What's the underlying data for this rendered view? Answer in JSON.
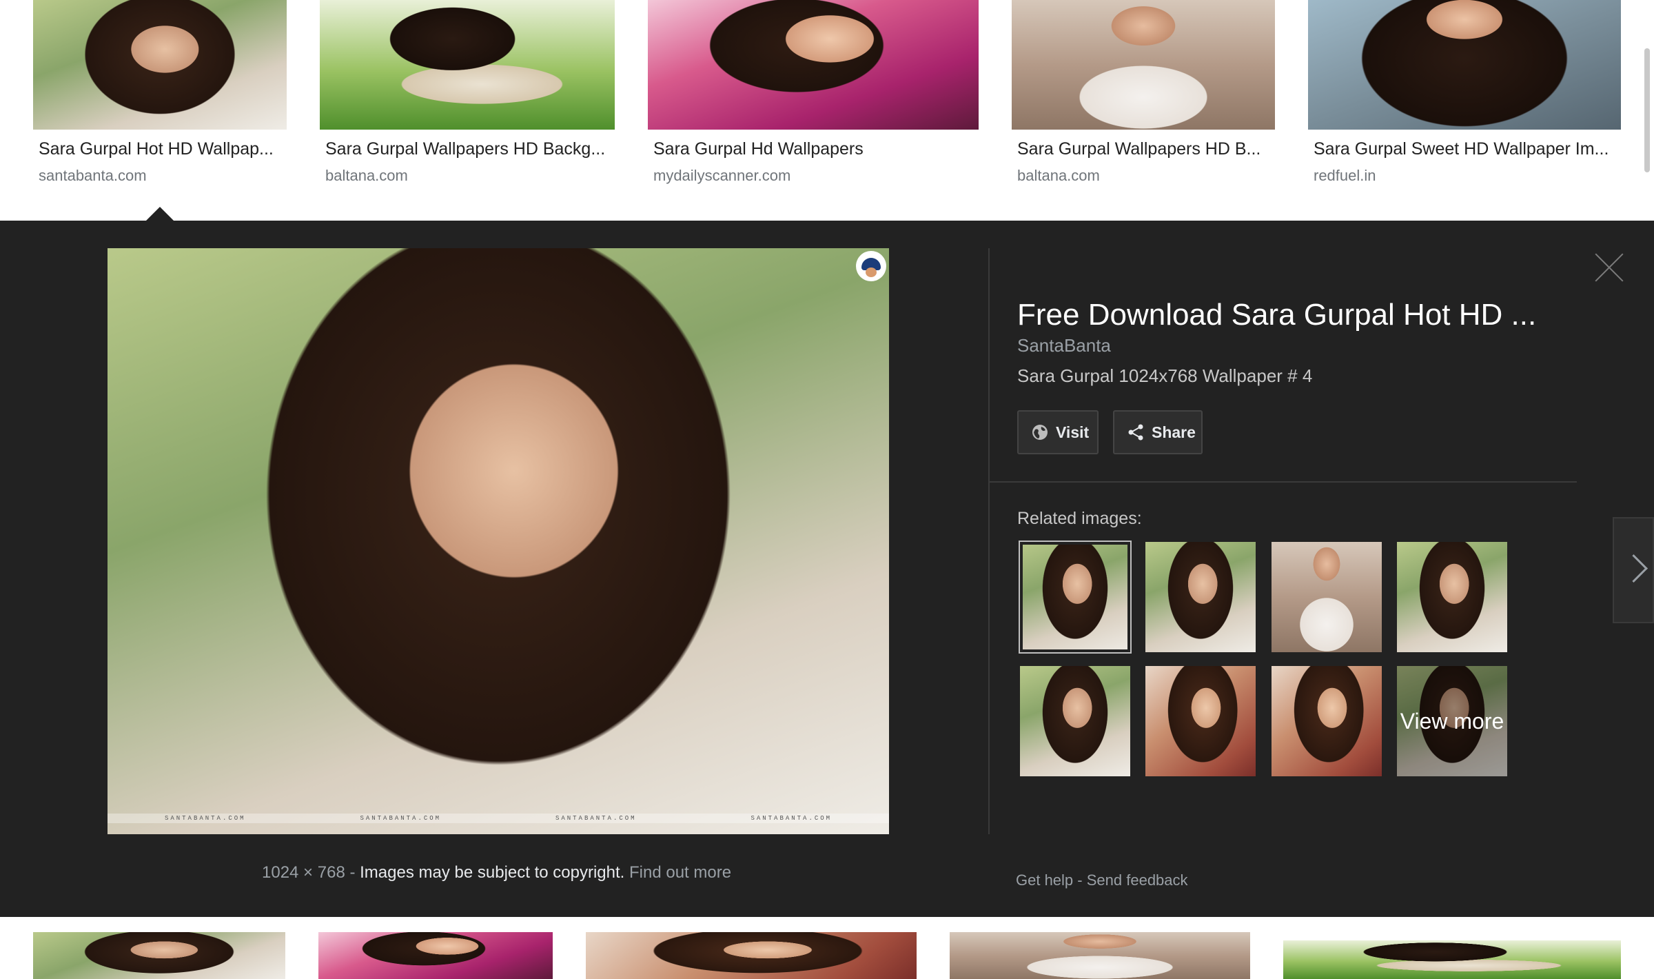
{
  "results_top": [
    {
      "title": "Sara Gurpal Hot HD Wallpap...",
      "source": "santabanta.com"
    },
    {
      "title": "Sara Gurpal Wallpapers HD Backg...",
      "source": "baltana.com"
    },
    {
      "title": "Sara Gurpal Hd Wallpapers",
      "source": "mydailyscanner.com"
    },
    {
      "title": "Sara Gurpal Wallpapers HD B...",
      "source": "baltana.com"
    },
    {
      "title": "Sara Gurpal Sweet HD Wallpaper Im...",
      "source": "redfuel.in"
    }
  ],
  "preview": {
    "title": "Free Download Sara Gurpal Hot HD ...",
    "site": "SantaBanta",
    "description": "Sara Gurpal 1024x768 Wallpaper # 4",
    "dimensions": "1024 × 768",
    "separator": "-",
    "copyright_notice": "Images may be subject to copyright.",
    "find_out_more": "Find out more",
    "watermark": "SANTABANTA.COM",
    "buttons": {
      "visit": "Visit",
      "share": "Share"
    },
    "related_label": "Related images:",
    "view_more": "View more",
    "footer": {
      "get_help": "Get help",
      "separator": "-",
      "send_feedback": "Send feedback"
    }
  },
  "icons": {
    "close": "close-icon",
    "visit": "globe-icon",
    "share": "share-icon",
    "next": "chevron-right-icon"
  },
  "colors": {
    "panel_bg": "#222222",
    "title_text": "#ffffff",
    "muted_text": "#9aa0a6"
  }
}
